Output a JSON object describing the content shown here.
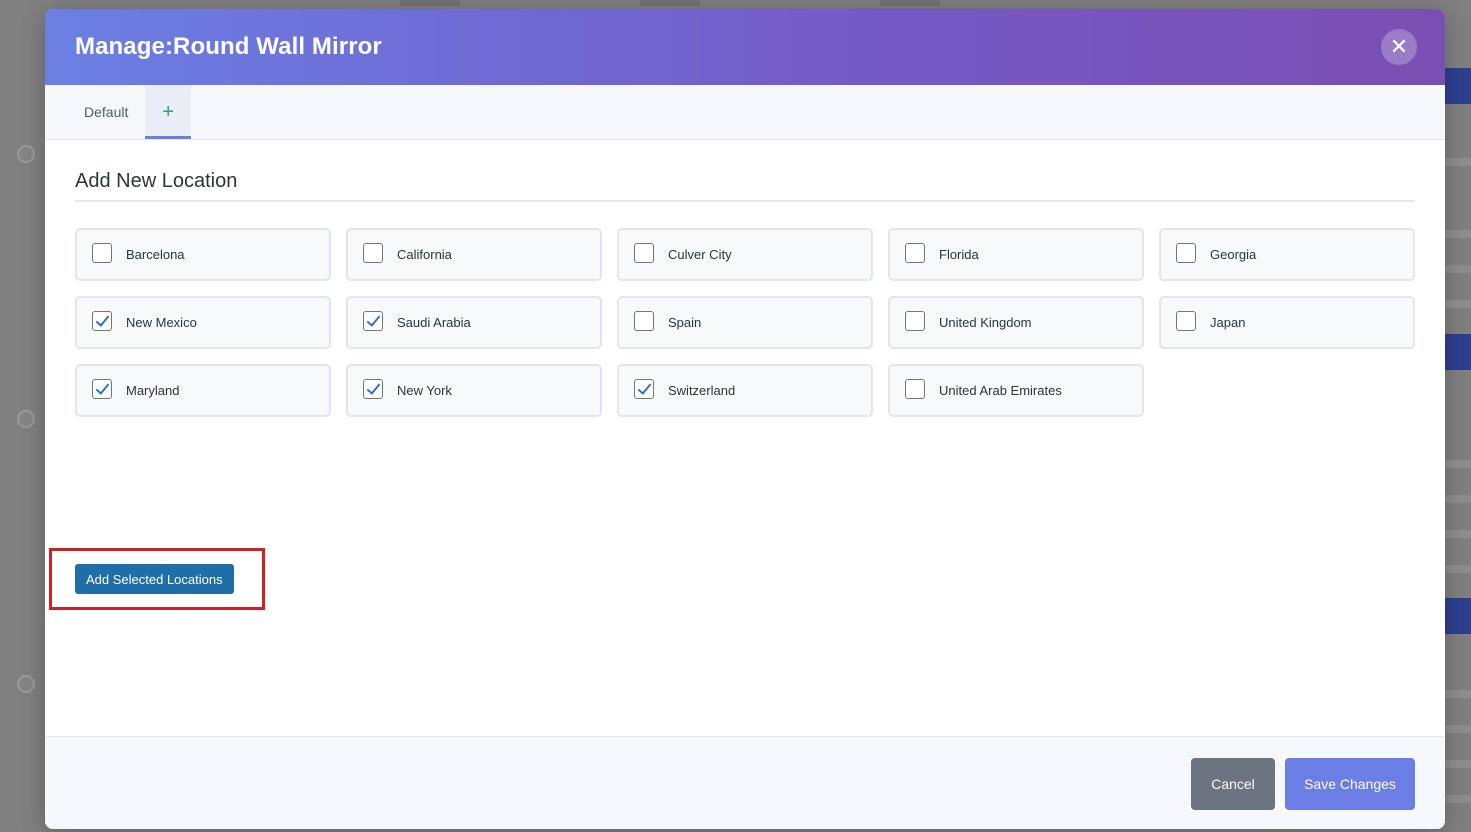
{
  "modal": {
    "title": "Manage:Round Wall Mirror",
    "close_icon": "close-icon"
  },
  "tabs": [
    {
      "label": "Default",
      "active": false
    },
    {
      "label": "+",
      "active": true
    }
  ],
  "section": {
    "title": "Add New Location"
  },
  "locations": [
    {
      "label": "Barcelona",
      "checked": false
    },
    {
      "label": "California",
      "checked": false
    },
    {
      "label": "Culver City",
      "checked": false
    },
    {
      "label": "Florida",
      "checked": false
    },
    {
      "label": "Georgia",
      "checked": false
    },
    {
      "label": "New Mexico",
      "checked": true
    },
    {
      "label": "Saudi Arabia",
      "checked": true
    },
    {
      "label": "Spain",
      "checked": false
    },
    {
      "label": "United Kingdom",
      "checked": false
    },
    {
      "label": "Japan",
      "checked": false
    },
    {
      "label": "Maryland",
      "checked": true
    },
    {
      "label": "New York",
      "checked": true
    },
    {
      "label": "Switzerland",
      "checked": true
    },
    {
      "label": "United Arab Emirates",
      "checked": false
    }
  ],
  "add_button": {
    "label": "Add Selected Locations"
  },
  "footer": {
    "cancel_label": "Cancel",
    "save_label": "Save Changes"
  },
  "colors": {
    "header_gradient_start": "#6b7fe3",
    "header_gradient_end": "#7a4fb2",
    "add_button": "#1f6ea8",
    "highlight_box": "#d01f27",
    "cancel_button": "#6c7481",
    "save_button": "#6a7ee6",
    "checkmark": "#2a73c9"
  }
}
